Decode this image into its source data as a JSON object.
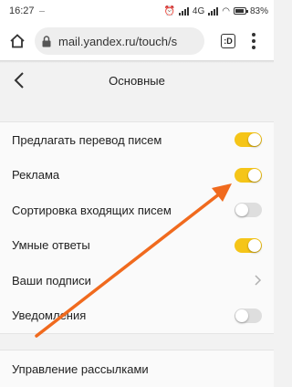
{
  "status_bar": {
    "time": "16:27",
    "network": "4G",
    "battery": "83%"
  },
  "browser": {
    "url": "mail.yandex.ru/touch/s",
    "tabs_label": ":D"
  },
  "page": {
    "title": "Основные"
  },
  "settings": [
    {
      "label": "Предлагать перевод писем",
      "control": "toggle",
      "state": "on"
    },
    {
      "label": "Реклама",
      "control": "toggle",
      "state": "on"
    },
    {
      "label": "Сортировка входящих писем",
      "control": "toggle",
      "state": "off"
    },
    {
      "label": "Умные ответы",
      "control": "toggle",
      "state": "on"
    },
    {
      "label": "Ваши подписи",
      "control": "chevron"
    },
    {
      "label": "Уведомления",
      "control": "toggle",
      "state": "off"
    }
  ],
  "settings_more": {
    "label": "Управление рассылками"
  },
  "colors": {
    "toggle_on": "#f5c518",
    "toggle_off": "#dedede",
    "annotation_arrow": "#f06a1e"
  }
}
